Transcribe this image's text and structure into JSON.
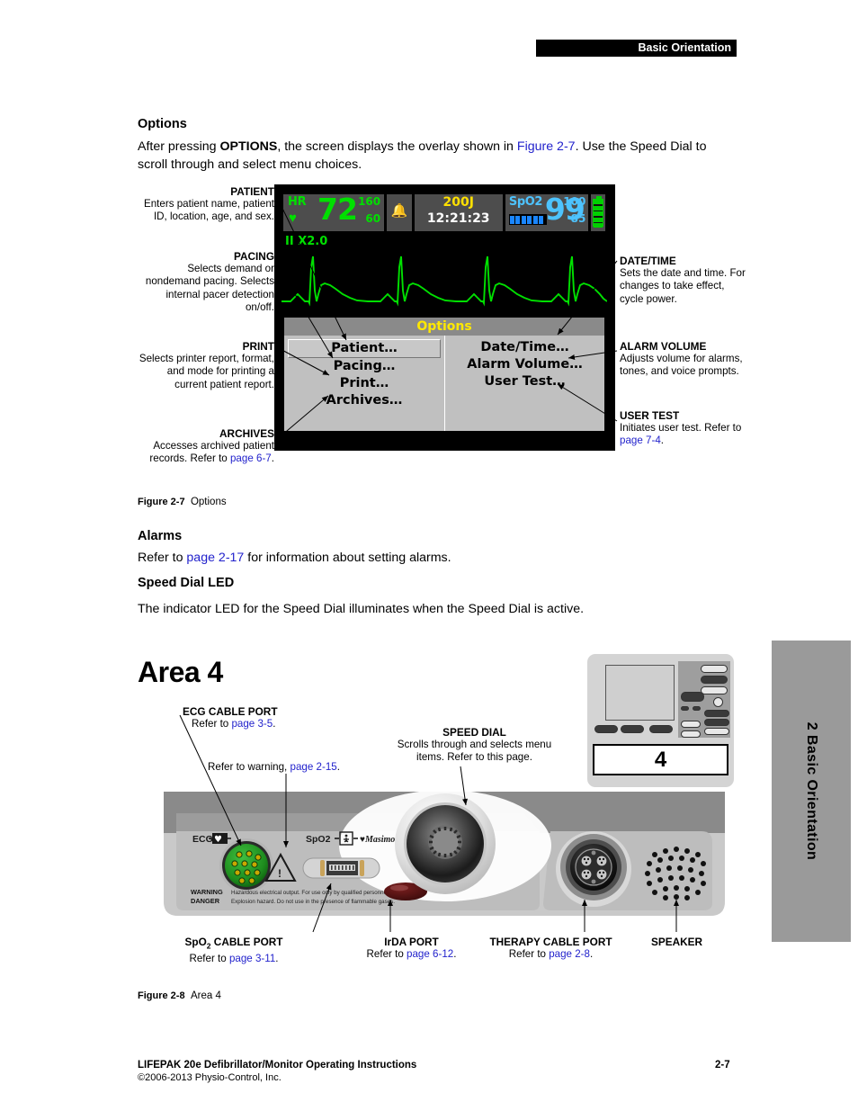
{
  "header": {
    "section_label": "Basic Orientation"
  },
  "side_tab": {
    "label": "2 Basic Orientation"
  },
  "sections": {
    "options": {
      "heading": "Options",
      "paragraph_1": "After pressing ",
      "paragraph_bold": "OPTIONS",
      "paragraph_2": ", the screen displays the overlay shown in ",
      "figure_ref": "Figure 2-7",
      "paragraph_3": ". Use the Speed Dial to scroll through and select menu choices."
    },
    "alarms": {
      "heading": "Alarms",
      "text_before": "Refer to ",
      "link": "page 2-17",
      "text_after": " for information about setting alarms."
    },
    "speed_dial_led": {
      "heading": "Speed Dial LED",
      "text": "The indicator LED for the Speed Dial illuminates when the Speed Dial is active."
    },
    "area4": {
      "heading": "Area 4"
    }
  },
  "monitor": {
    "hr": {
      "label": "HR",
      "value": "72",
      "limit_high": "160",
      "limit_low": "60",
      "heart_icon": "heart-icon"
    },
    "alarm_bell": {
      "icon": "bell-icon"
    },
    "energy": {
      "value": "200J",
      "time": "12:21:23"
    },
    "spo2": {
      "label": "SpO2",
      "value": "99",
      "limit_high": "100",
      "limit_low": "85"
    },
    "battery": {
      "icon": "battery-icon"
    },
    "lead": "II  X2.0",
    "options_menu": {
      "title": "Options",
      "left_items": [
        "Patient…",
        "Pacing…",
        "Print…",
        "Archives…"
      ],
      "right_items": [
        "Date/Time…",
        "Alarm Volume…",
        "User Test…"
      ],
      "selected": "Patient…"
    },
    "colors": {
      "hr_green": "#00e000",
      "spo2_blue": "#4dc3ff",
      "energy_yellow": "#ffe000",
      "title_yellow": "#ffe800",
      "bell_amber": "#ffb000"
    }
  },
  "callouts_fig27": {
    "left": [
      {
        "title": "PATIENT",
        "body": "Enters patient name, patient ID, location, age, and sex."
      },
      {
        "title": "PACING",
        "body": "Selects demand or nondemand pacing.",
        "body2": "Selects internal pacer detection on/off."
      },
      {
        "title": "PRINT",
        "body": "Selects printer report, format, and mode for printing a current patient report."
      },
      {
        "title": "ARCHIVES",
        "body": "Accesses archived patient records.",
        "link_prefix": "Refer to ",
        "link": "page 6-7",
        "link_suffix": "."
      }
    ],
    "right": [
      {
        "title": "DATE/TIME",
        "body": "Sets the date and time. For changes to take effect, cycle power."
      },
      {
        "title": "ALARM VOLUME",
        "body": "Adjusts volume for alarms, tones, and voice prompts."
      },
      {
        "title": "USER TEST",
        "body": "Initiates user test.",
        "link_prefix": "Refer to ",
        "link": "page 7-4",
        "link_suffix": "."
      }
    ]
  },
  "figure_captions": {
    "fig_2_7": {
      "number": "Figure 2-7",
      "title": "Options"
    },
    "fig_2_8": {
      "number": "Figure 2-8",
      "title": "Area 4"
    }
  },
  "callouts_fig28": {
    "ecg_cable_port": {
      "title": "ECG CABLE PORT",
      "link_prefix": "Refer to ",
      "link": "page 3-5",
      "link_suffix": "."
    },
    "warning_ref": {
      "prefix": "Refer to warning, ",
      "link": "page 2-15",
      "suffix": "."
    },
    "speed_dial": {
      "title": "SPEED DIAL",
      "body": "Scrolls through and selects menu items. Refer to this page."
    },
    "spo2_cable_port": {
      "title_main": "SpO",
      "title_sub": "2",
      "title_rest": " CABLE PORT",
      "link_prefix": "Refer to ",
      "link": "page 3-11",
      "link_suffix": "."
    },
    "irda_port": {
      "title": "IrDA PORT",
      "link_prefix": "Refer to ",
      "link": "page 6-12",
      "link_suffix": "."
    },
    "therapy_cable_port": {
      "title": "THERAPY CABLE PORT",
      "link_prefix": "Refer to ",
      "link": "page 2-8",
      "link_suffix": "."
    },
    "speaker": {
      "title": "SPEAKER"
    }
  },
  "device_panel": {
    "ecg_label": "ECG",
    "spo2_label": "SpO2",
    "masimo_label": "Masimo SET",
    "warning_word": "WARNING",
    "warning_text": "Hazardous electrical output. For use only by qualified personnel.",
    "danger_word": "DANGER",
    "danger_text": "Explosion hazard. Do not use in the presence of flammable gases."
  },
  "thumbnail": {
    "area_number": "4"
  },
  "footer": {
    "title": "LIFEPAK 20e Defibrillator/Monitor Operating Instructions",
    "copyright": "©2006-2013 Physio-Control, Inc.",
    "page": "2-7"
  }
}
